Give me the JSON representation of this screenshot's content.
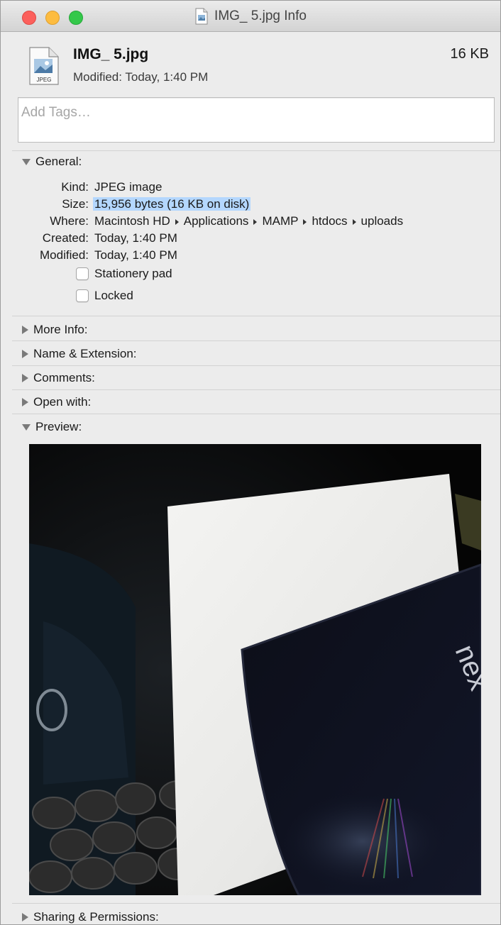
{
  "window": {
    "title": "IMG_ 5.jpg Info"
  },
  "header": {
    "file_name": "IMG_ 5.jpg",
    "modified": "Modified: Today, 1:40 PM",
    "size": "16 KB",
    "icon_label": "JPEG"
  },
  "tags": {
    "placeholder": "Add Tags…"
  },
  "general": {
    "title": "General:",
    "kind_label": "Kind:",
    "kind": "JPEG image",
    "size_label": "Size:",
    "size": "15,956 bytes (16 KB on disk)",
    "where_label": "Where:",
    "where_path": [
      "Macintosh HD",
      "Applications",
      "MAMP",
      "htdocs",
      "uploads"
    ],
    "created_label": "Created:",
    "created": "Today, 1:40 PM",
    "modified_label": "Modified:",
    "modified": "Today, 1:40 PM",
    "stationery": "Stationery pad",
    "locked": "Locked"
  },
  "sections": {
    "more_info": "More Info:",
    "name_extension": "Name & Extension:",
    "comments": "Comments:",
    "open_with": "Open with:",
    "preview": "Preview:",
    "sharing": "Sharing & Permissions:"
  },
  "preview": {
    "device_text": "nex"
  },
  "colors": {
    "selection": "#b4d7fe",
    "close": "#fc605c",
    "minimize": "#fdbc40",
    "zoom": "#34c84a"
  }
}
